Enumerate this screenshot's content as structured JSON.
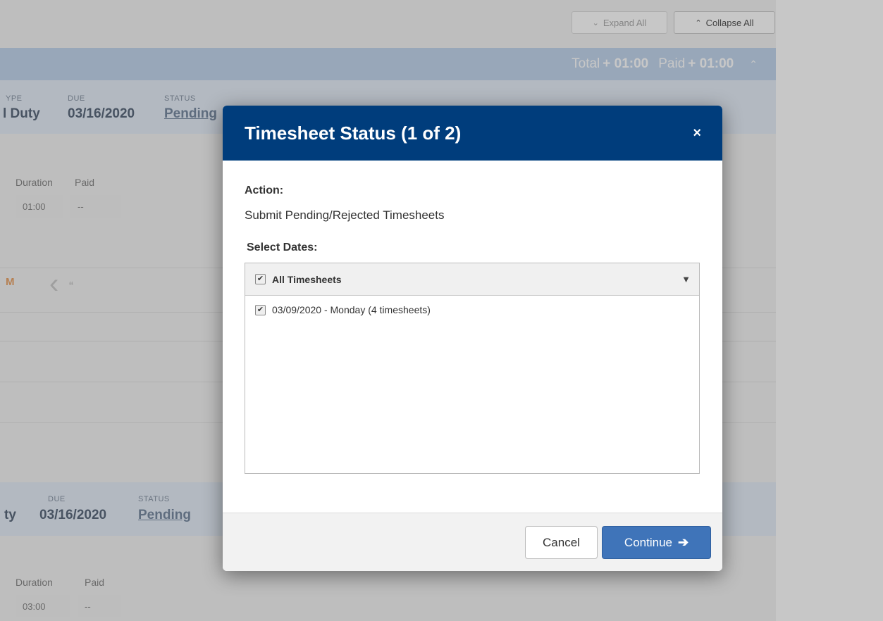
{
  "toolbar": {
    "expand_all": "Expand All",
    "collapse_all": "Collapse All"
  },
  "summary": {
    "total_label": "Total",
    "total_value": "+ 01:00",
    "paid_label": "Paid",
    "paid_value": "+ 01:00"
  },
  "timesheets": [
    {
      "type_label": "YPE",
      "type_value": "l Duty",
      "due_label": "DUE",
      "due_value": "03/16/2020",
      "status_label": "STATUS",
      "status_value": "Pending",
      "duration_label": "Duration",
      "duration_value": "01:00",
      "paid_label": "Paid",
      "paid_value": "--",
      "marker": "M"
    },
    {
      "type_value": "ty",
      "due_label": "DUE",
      "due_value": "03/16/2020",
      "status_label": "STATUS",
      "status_value": "Pending",
      "duration_label": "Duration",
      "duration_value": "03:00",
      "paid_label": "Paid",
      "paid_value": "--"
    }
  ],
  "modal": {
    "title": "Timesheet Status (1 of 2)",
    "close_icon": "×",
    "action_label": "Action:",
    "action_value": "Submit Pending/Rejected Timesheets",
    "select_label": "Select Dates:",
    "list_header": "All Timesheets",
    "items": [
      {
        "label": "03/09/2020 - Monday (4 timesheets)",
        "checked": true
      }
    ],
    "cancel_label": "Cancel",
    "continue_label": "Continue",
    "colors": {
      "header": "#003d7c",
      "primary_button": "#3f74b9"
    }
  }
}
